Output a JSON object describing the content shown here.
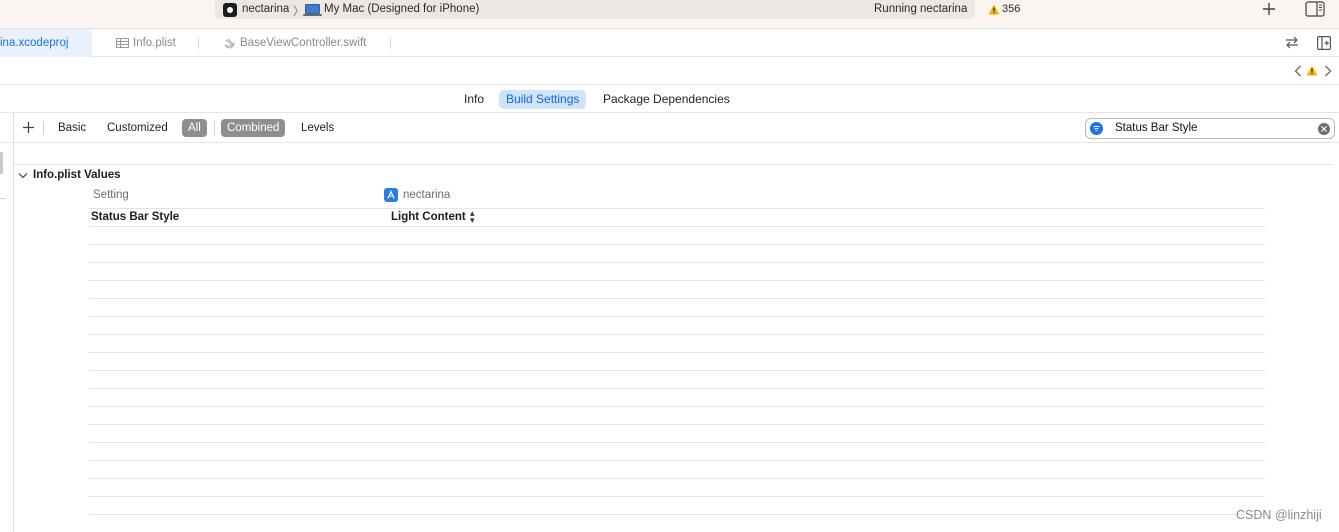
{
  "toolbar": {
    "scheme": "nectarina",
    "destination": "My Mac (Designed for iPhone)",
    "status": "Running nectarina",
    "warning_count": "356"
  },
  "tabs": [
    {
      "label": "ina.xcodeproj",
      "active": true
    },
    {
      "label": "Info.plist",
      "active": false
    },
    {
      "label": "BaseViewController.swift",
      "active": false
    }
  ],
  "segments": {
    "info": "Info",
    "build_settings": "Build Settings",
    "package_dependencies": "Package Dependencies"
  },
  "filters": {
    "basic": "Basic",
    "customized": "Customized",
    "all": "All",
    "combined": "Combined",
    "levels": "Levels"
  },
  "search": {
    "value": "Status Bar Style"
  },
  "section": {
    "title": "Info.plist Values",
    "col_setting": "Setting",
    "col_target": "nectarina",
    "rows": [
      {
        "setting": "Status Bar Style",
        "value": "Light Content"
      }
    ]
  },
  "watermark": "CSDN @linzhiji",
  "colors": {
    "accent": "#1a73e8",
    "selected_segment_bg": "#cfe3fb",
    "selected_filter_bg": "#8e8e8e",
    "warning": "#f5b800"
  }
}
